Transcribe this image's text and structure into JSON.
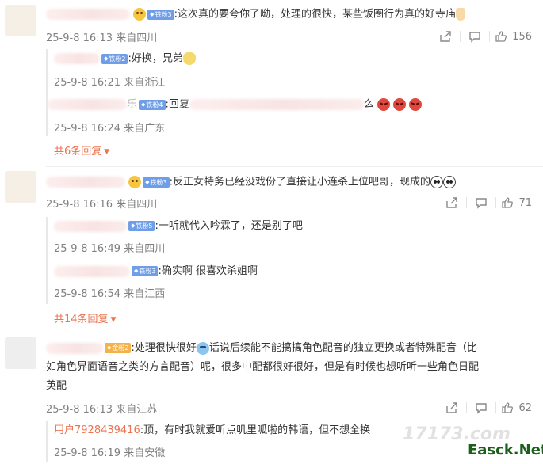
{
  "comments": [
    {
      "text": ":这次真的要夸你了呦，处理的很快，某些饭圈行为真的好寺庙",
      "badge": "铁粉3",
      "meta": "25-9-8 16:13 来自四川",
      "likes": "156",
      "replies": [
        {
          "badge": "铁粉2",
          "text": ":好换，兄弟",
          "meta": "25-9-8 16:21 来自浙江"
        },
        {
          "badge": "铁粉4",
          "text_prefix": ":回复",
          "name_tail": "乐",
          "text_tail": "么",
          "meta": "25-9-8 16:24 来自广东"
        }
      ],
      "more": "共6条回复"
    },
    {
      "text": ":反正女特务已经没戏份了直接让小连杀上位吧哥，现成的",
      "badge": "铁粉3",
      "meta": "25-9-8 16:16 来自四川",
      "likes": "71",
      "replies": [
        {
          "badge": "铁粉5",
          "text": ":一听就代入吟霖了，还是别了吧",
          "meta": "25-9-8 16:49 来自四川"
        },
        {
          "badge": "铁粉3",
          "text": ":确实啊 很喜欢杀姐啊",
          "meta": "25-9-8 16:54 来自江西"
        }
      ],
      "more": "共14条回复"
    },
    {
      "text_line1": ":处理很快很好",
      "text_line1b": "话说后续能不能搞搞角色配音的独立更换或者特殊配音（比",
      "text_line2": "如角色界面语音之类的方言配音）呢，很多中配都很好很好，但是有时候也想听听一些角色日配",
      "text_line3": "英配",
      "badge": "金粉2",
      "meta": "25-9-8 16:13 来自江苏",
      "likes": "62",
      "replies": [
        {
          "name": "用户7928439416",
          "text": ":顶，有时我就爱听点叽里呱啦的韩语，但不想全换",
          "meta": "25-9-8 16:19 来自安徽"
        }
      ]
    }
  ],
  "icons": {
    "share": "share-icon",
    "comment": "comment-icon",
    "like": "thumbs-up-icon"
  },
  "watermarks": {
    "site1": "17173.com",
    "site2": "Easck.Net"
  },
  "colors": {
    "accent": "#eb7350",
    "badge_blue": "#6f9ee8",
    "badge_gold": "#f3b24a",
    "meta": "#808080"
  }
}
